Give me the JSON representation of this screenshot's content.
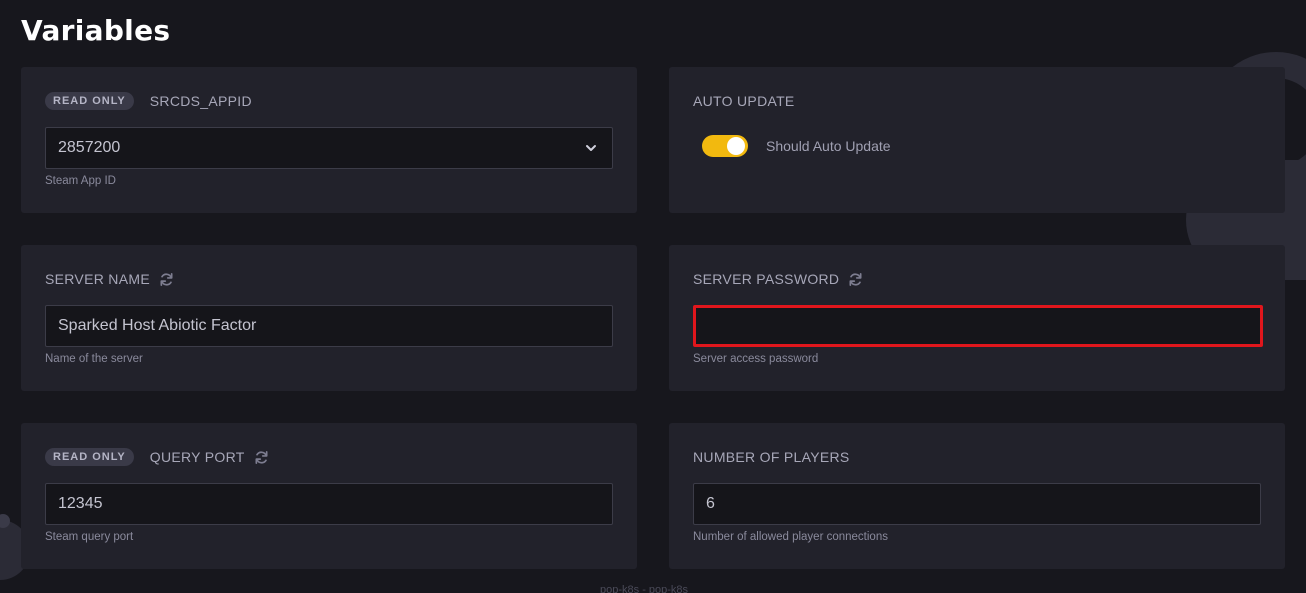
{
  "page": {
    "title": "Variables"
  },
  "cards": {
    "appid": {
      "badge": "READ ONLY",
      "label": "SRCDS_APPID",
      "value": "2857200",
      "help": "Steam App ID"
    },
    "auto_update": {
      "label": "AUTO UPDATE",
      "toggle_label": "Should Auto Update",
      "enabled": true
    },
    "server_name": {
      "label": "SERVER NAME",
      "value": "Sparked Host Abiotic Factor",
      "help": "Name of the server"
    },
    "server_password": {
      "label": "SERVER PASSWORD",
      "value": "",
      "help": "Server access password"
    },
    "query_port": {
      "badge": "READ ONLY",
      "label": "QUERY PORT",
      "value": "12345",
      "help": "Steam query port"
    },
    "num_players": {
      "label": "NUMBER OF PLAYERS",
      "value": "6",
      "help": "Number of allowed player connections"
    }
  },
  "footer": {
    "text": "pop-k8s - pop-k8s"
  },
  "colors": {
    "background": "#17171d",
    "card": "#22222b",
    "toggle_on": "#f2b90f",
    "error_border": "#e0161c"
  }
}
